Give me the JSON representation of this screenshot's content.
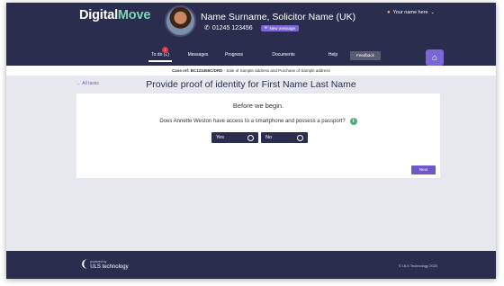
{
  "header": {
    "brand_primary": "Digital",
    "brand_accent": "Move",
    "person_name": "Name Surname, Solicitor Name (UK)",
    "phone": "01245 123456",
    "new_message_label": "New message",
    "user_menu_label": "Your name here",
    "icons": {
      "phone": "phone-icon",
      "message": "chat-icon",
      "user": "user-icon",
      "settings": "home-gear-icon"
    }
  },
  "nav": {
    "items": [
      {
        "label": "To do (1)",
        "badge": "1"
      },
      {
        "label": "Messages"
      },
      {
        "label": "Progress"
      },
      {
        "label": "Documents"
      },
      {
        "label": "Help"
      },
      {
        "label": "Feedback"
      }
    ]
  },
  "case_bar": {
    "label": "Case ref: BC123456C/DRD",
    "text": " - Sale of Sample address and Purchase of Sample address"
  },
  "subheader": {
    "back_label": "All tasks",
    "title": "Provide proof of identity for First Name Last Name"
  },
  "card": {
    "intro": "Before we begin.",
    "question": "Does Annette Weston have access to a smartphone and possess a passport?",
    "options": [
      "Yes",
      "No"
    ],
    "next_label": "Next"
  },
  "footer": {
    "powered_by": "powered by",
    "brand": "ULS technology",
    "copyright": "© ULS Technology 2020"
  },
  "colors": {
    "navy": "#2b2d4f",
    "purple": "#7b66d6",
    "accent_green": "#7fd4b8",
    "background": "#e6e8ed"
  }
}
